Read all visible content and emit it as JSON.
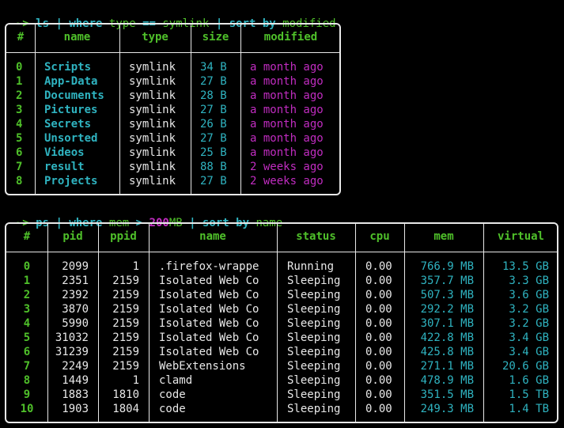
{
  "cmd1": {
    "prompt": "~>",
    "parts": [
      "ls",
      "|",
      "where",
      "type",
      "==",
      "symlink",
      "|",
      "sort-by",
      "modified"
    ]
  },
  "table1": {
    "headers": [
      "#",
      "name",
      "type",
      "size",
      "modified"
    ],
    "rows": [
      [
        "0",
        "Scripts",
        "symlink",
        "34 B",
        "a month ago"
      ],
      [
        "1",
        "App-Data",
        "symlink",
        "27 B",
        "a month ago"
      ],
      [
        "2",
        "Documents",
        "symlink",
        "28 B",
        "a month ago"
      ],
      [
        "3",
        "Pictures",
        "symlink",
        "27 B",
        "a month ago"
      ],
      [
        "4",
        "Secrets",
        "symlink",
        "26 B",
        "a month ago"
      ],
      [
        "5",
        "Unsorted",
        "symlink",
        "27 B",
        "a month ago"
      ],
      [
        "6",
        "Videos",
        "symlink",
        "25 B",
        "a month ago"
      ],
      [
        "7",
        "result",
        "symlink",
        "88 B",
        "2 weeks ago"
      ],
      [
        "8",
        "Projects",
        "symlink",
        "27 B",
        "2 weeks ago"
      ]
    ]
  },
  "cmd2": {
    "prompt": "~>",
    "parts": [
      "ps",
      "|",
      "where",
      "mem",
      ">",
      "200",
      "MB",
      "|",
      "sort-by",
      "name"
    ]
  },
  "table2": {
    "headers": [
      "#",
      "pid",
      "ppid",
      "name",
      "status",
      "cpu",
      "mem",
      "virtual"
    ],
    "rows": [
      [
        "0",
        "2099",
        "1",
        ".firefox-wrappe",
        "Running",
        "0.00",
        "766.9 MB",
        "13.5 GB"
      ],
      [
        "1",
        "2351",
        "2159",
        "Isolated Web Co",
        "Sleeping",
        "0.00",
        "357.7 MB",
        "3.3 GB"
      ],
      [
        "2",
        "2392",
        "2159",
        "Isolated Web Co",
        "Sleeping",
        "0.00",
        "507.3 MB",
        "3.6 GB"
      ],
      [
        "3",
        "3870",
        "2159",
        "Isolated Web Co",
        "Sleeping",
        "0.00",
        "292.2 MB",
        "3.2 GB"
      ],
      [
        "4",
        "5990",
        "2159",
        "Isolated Web Co",
        "Sleeping",
        "0.00",
        "307.1 MB",
        "3.2 GB"
      ],
      [
        "5",
        "31032",
        "2159",
        "Isolated Web Co",
        "Sleeping",
        "0.00",
        "422.8 MB",
        "3.4 GB"
      ],
      [
        "6",
        "31239",
        "2159",
        "Isolated Web Co",
        "Sleeping",
        "0.00",
        "425.8 MB",
        "3.4 GB"
      ],
      [
        "7",
        "2249",
        "2159",
        "WebExtensions",
        "Sleeping",
        "0.00",
        "271.1 MB",
        "20.6 GB"
      ],
      [
        "8",
        "1449",
        "1",
        "clamd",
        "Sleeping",
        "0.00",
        "478.9 MB",
        "1.6 GB"
      ],
      [
        "9",
        "1883",
        "1810",
        "code",
        "Sleeping",
        "0.00",
        "351.5 MB",
        "1.5 TB"
      ],
      [
        "10",
        "1903",
        "1804",
        "code",
        "Sleeping",
        "0.00",
        "249.3 MB",
        "1.4 TB"
      ]
    ]
  }
}
